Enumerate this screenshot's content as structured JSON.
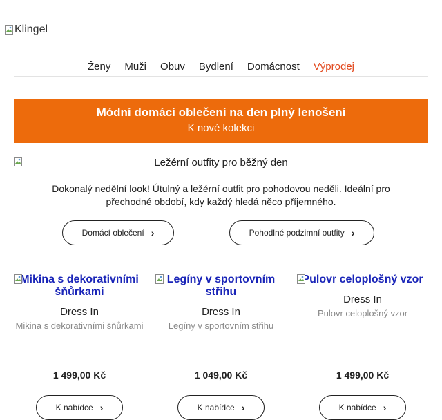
{
  "logo": {
    "alt": "Klingel"
  },
  "nav": {
    "items": [
      "Ženy",
      "Muži",
      "Obuv",
      "Bydlení",
      "Domácnost"
    ],
    "sale": "Výprodej"
  },
  "banner": {
    "title": "Módní domácí oblečení na den plný lenošení",
    "subtitle": "K nové kolekci"
  },
  "hero": {
    "alt": "Ležérní outfity pro běžný den"
  },
  "intro": "Dokonalý nedělní look! Útulný a ležérní outfit pro pohodovou neděli. Ideální pro přechodné období, kdy každý hledá něco příjemného.",
  "ctas": [
    "Domácí oblečení",
    "Pohodlné podzimní outfity"
  ],
  "products": [
    {
      "title": "Mikina s dekorativními šňůrkami",
      "brand": "Dress In",
      "desc": "Mikina s dekorativními šňůrkami",
      "price": "1 499,00 Kč",
      "button": "K nabídce"
    },
    {
      "title": "Legíny v sportovním střihu",
      "brand": "Dress In",
      "desc": "Legíny v sportovním střihu",
      "price": "1 049,00 Kč",
      "button": "K nabídce"
    },
    {
      "title": "Pulovr celoplošný vzor",
      "brand": "Dress In",
      "desc": "Pulovr celoplošný vzor",
      "price": "1 499,00 Kč",
      "button": "K nabídce"
    }
  ],
  "chevron": "›"
}
